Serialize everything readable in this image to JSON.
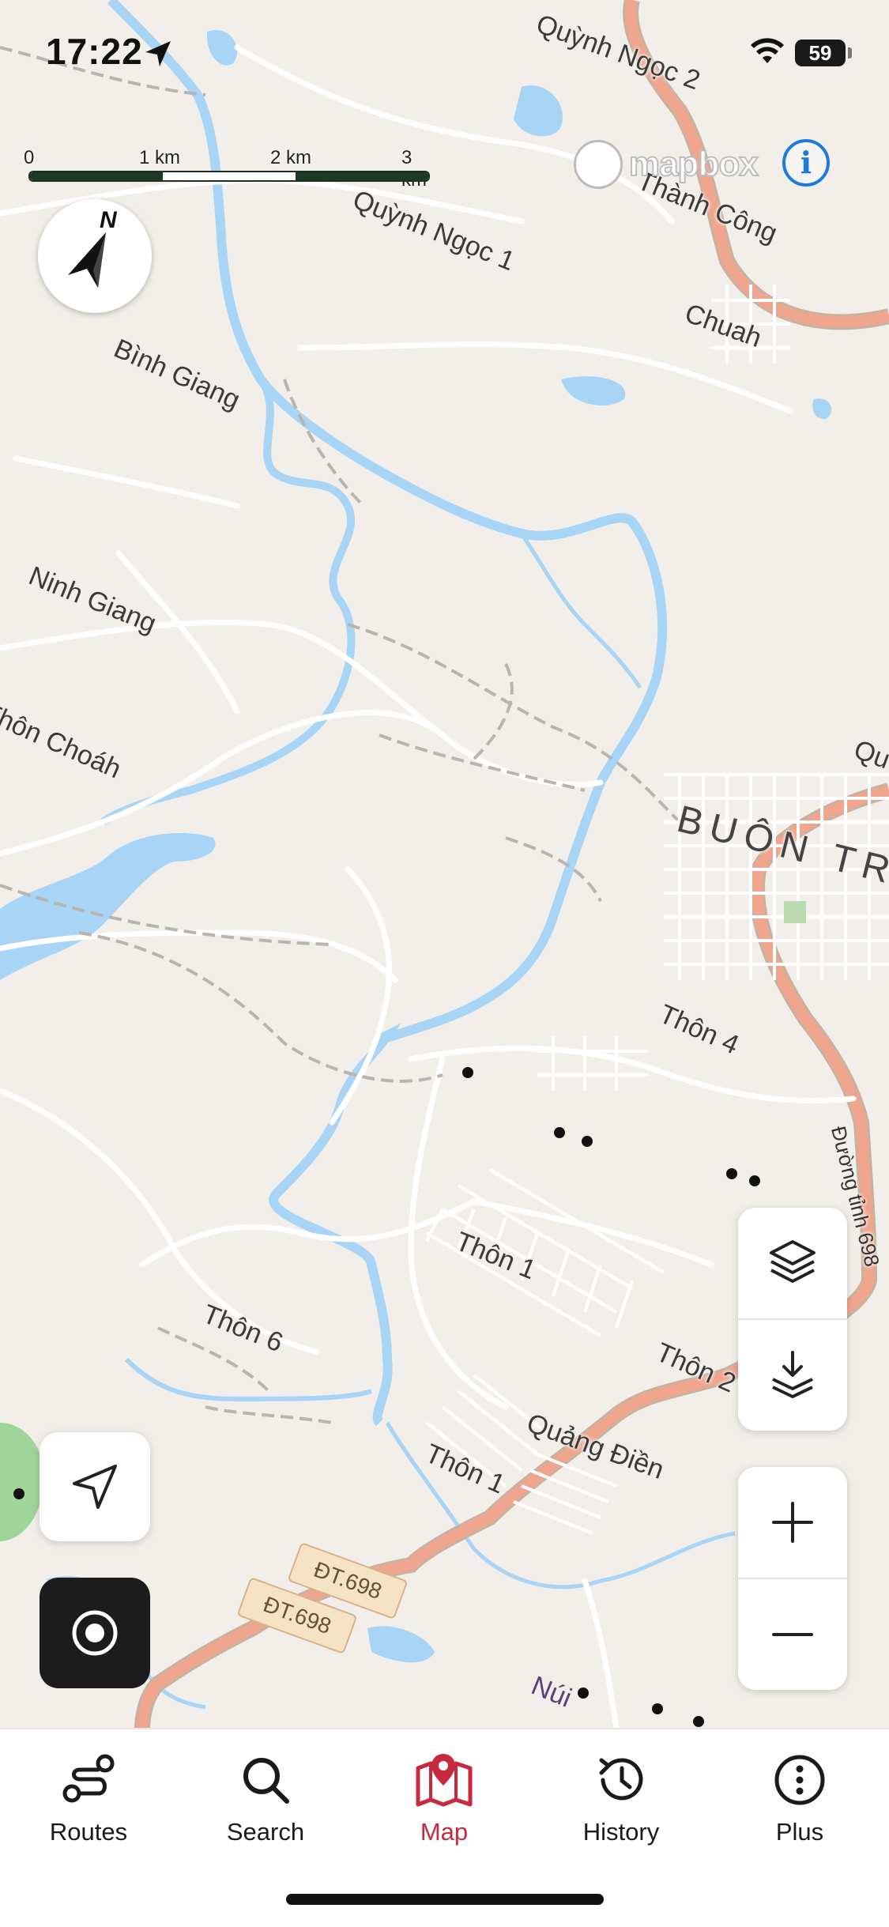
{
  "status": {
    "time": "17:22",
    "battery": "59"
  },
  "scale": {
    "labels": [
      "0",
      "1 km",
      "2 km",
      "3 km"
    ]
  },
  "attribution": {
    "logo_text": "mapbox",
    "info_label": "i"
  },
  "compass": {
    "letter": "N"
  },
  "places": {
    "quynh_ngoc_2": "Quỳnh Ngọc 2",
    "quynh_ngoc_1": "Quỳnh Ngọc 1",
    "thanh_cong": "Thành Công",
    "chuah": "Chuah",
    "binh_giang": "Bình Giang",
    "ninh_giang": "Ninh Giang",
    "thon_choah": "Thôn Choáh",
    "buon_trap": "BUÔN TRA",
    "qu_edge": "Qu",
    "thon_4": "Thôn 4",
    "duong_tinh": "Đường tỉnh 698",
    "thon_1_a": "Thôn 1",
    "thon_6": "Thôn 6",
    "thon_2": "Thôn 2",
    "quang_dien": "Quảng Điền",
    "thon_1_b": "Thôn 1",
    "nui": "Núi"
  },
  "shields": {
    "a": "ĐT.698",
    "b": "ĐT.698"
  },
  "colors": {
    "water": "#a8d4f5",
    "primary_road": "#f0a58f",
    "accent": "#c7293f",
    "park": "#9fd49a"
  },
  "tabs": [
    {
      "label": "Routes",
      "icon": "routes-icon"
    },
    {
      "label": "Search",
      "icon": "search-icon"
    },
    {
      "label": "Map",
      "icon": "map-icon"
    },
    {
      "label": "History",
      "icon": "history-icon"
    },
    {
      "label": "Plus",
      "icon": "more-icon"
    }
  ],
  "active_tab": "Map"
}
